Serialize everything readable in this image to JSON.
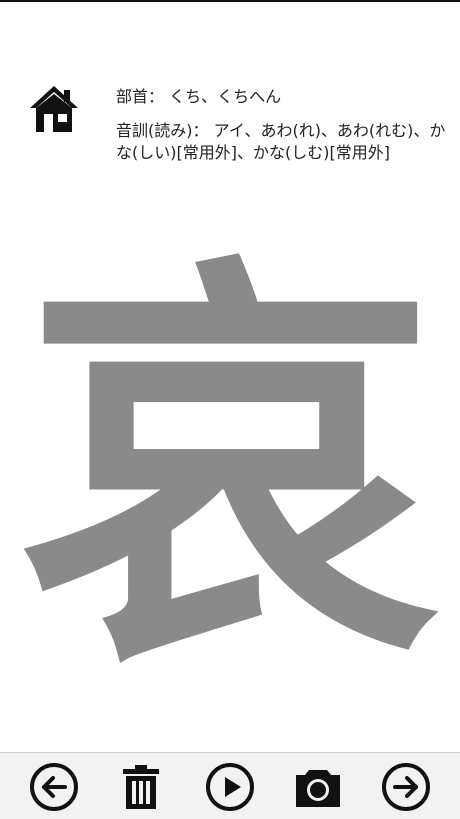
{
  "info": {
    "radical_line": "部首： くち、くちへん",
    "reading_line": "音訓(読み)： アイ、あわ(れ)、あわ(れむ)、かな(しい)[常用外]、かな(しむ)[常用外]"
  },
  "kanji": {
    "character": "哀",
    "color": "#8a8a8a"
  },
  "toolbar": {
    "items": [
      {
        "icon": "arrow-left-circle-icon"
      },
      {
        "icon": "trash-icon"
      },
      {
        "icon": "play-circle-icon"
      },
      {
        "icon": "camera-icon"
      },
      {
        "icon": "arrow-right-circle-icon"
      }
    ]
  },
  "colors": {
    "toolbar_bg": "#f2f2f2",
    "icon": "#111111"
  }
}
